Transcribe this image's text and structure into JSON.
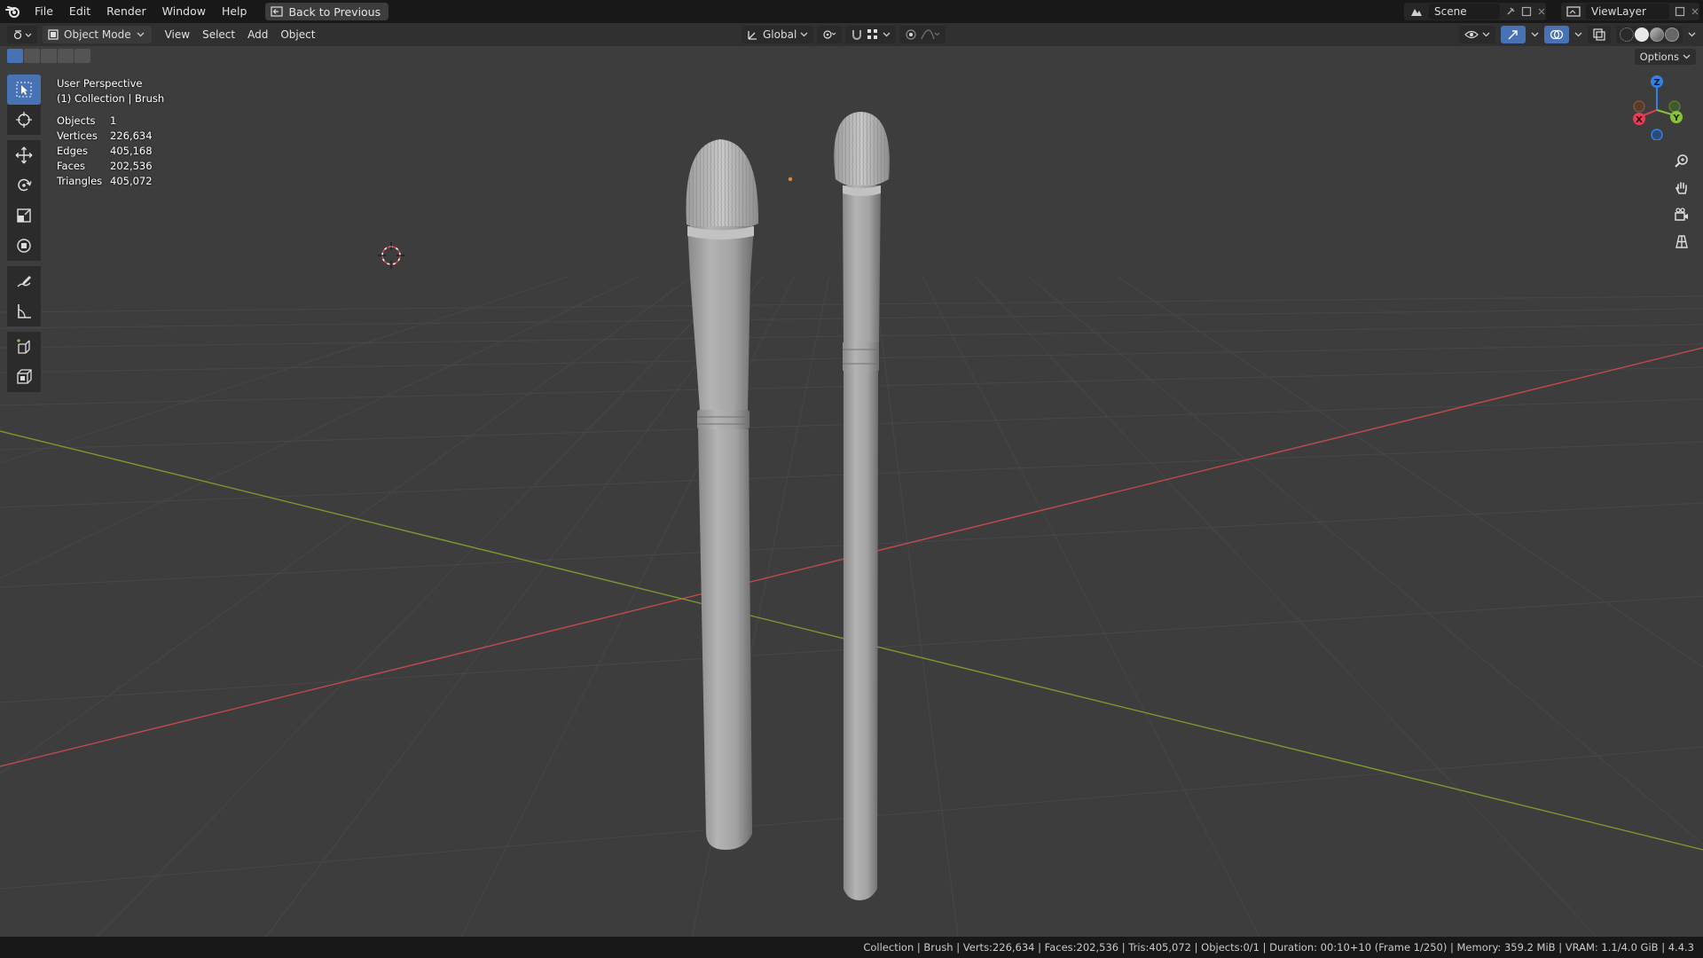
{
  "menubar": {
    "items": [
      "File",
      "Edit",
      "Render",
      "Window",
      "Help"
    ],
    "back_button": "Back to Previous",
    "scene": "Scene",
    "view_layer": "ViewLayer"
  },
  "viewport_header": {
    "mode": "Object Mode",
    "menus": [
      "View",
      "Select",
      "Add",
      "Object"
    ],
    "transform_orientation": "Global",
    "options": "Options"
  },
  "overlay": {
    "perspective": "User Perspective",
    "collection": "(1) Collection | Brush",
    "stats": [
      {
        "label": "Objects",
        "value": "1"
      },
      {
        "label": "Vertices",
        "value": "226,634"
      },
      {
        "label": "Edges",
        "value": "405,168"
      },
      {
        "label": "Faces",
        "value": "202,536"
      },
      {
        "label": "Triangles",
        "value": "405,072"
      }
    ]
  },
  "gizmo": {
    "x": "X",
    "y": "Y",
    "z": "Z"
  },
  "toolbar": {
    "tools": [
      "select-box",
      "cursor",
      "move",
      "rotate",
      "scale",
      "transform",
      "annotate",
      "measure",
      "add-cube",
      "add-object"
    ]
  },
  "statusbar": {
    "text": "Collection | Brush | Verts:226,634 | Faces:202,536 | Tris:405,072 | Objects:0/1 | Duration: 00:10+10 (Frame 1/250) | Memory: 359.2 MiB | VRAM: 1.1/4.0 GiB | 4.4.3"
  },
  "colors": {
    "accent": "#4772b3",
    "viewport_bg": "#3d3d3d",
    "x_axis": "#c44a4a",
    "y_axis": "#7a9a2e",
    "gizmo_x": "#e43c53",
    "gizmo_y": "#88c23b",
    "gizmo_z": "#3680e4"
  }
}
